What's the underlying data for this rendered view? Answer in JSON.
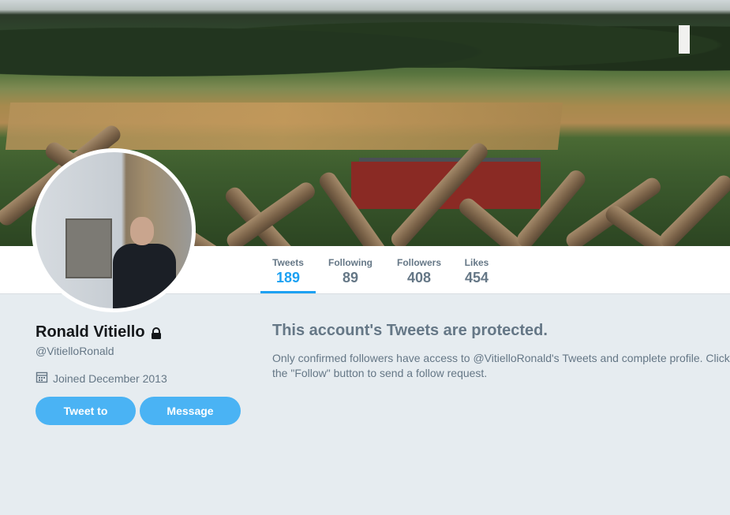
{
  "profile": {
    "name": "Ronald Vitiello",
    "handle": "@VitielloRonald",
    "joined": "Joined December 2013"
  },
  "nav": {
    "items": [
      {
        "label": "Tweets",
        "value": "189"
      },
      {
        "label": "Following",
        "value": "89"
      },
      {
        "label": "Followers",
        "value": "408"
      },
      {
        "label": "Likes",
        "value": "454"
      }
    ]
  },
  "buttons": {
    "tweet_to": "Tweet to",
    "message": "Message"
  },
  "protected": {
    "title": "This account's Tweets are protected.",
    "body": "Only confirmed followers have access to @VitielloRonald's Tweets and complete profile. Click the \"Follow\" button to send a follow request."
  },
  "colors": {
    "accent": "#1da1f2",
    "button": "#4ab3f4",
    "muted_text": "#657786",
    "background": "#e6ecf0"
  },
  "icons": {
    "lock": "lock-icon",
    "calendar": "calendar-icon"
  }
}
